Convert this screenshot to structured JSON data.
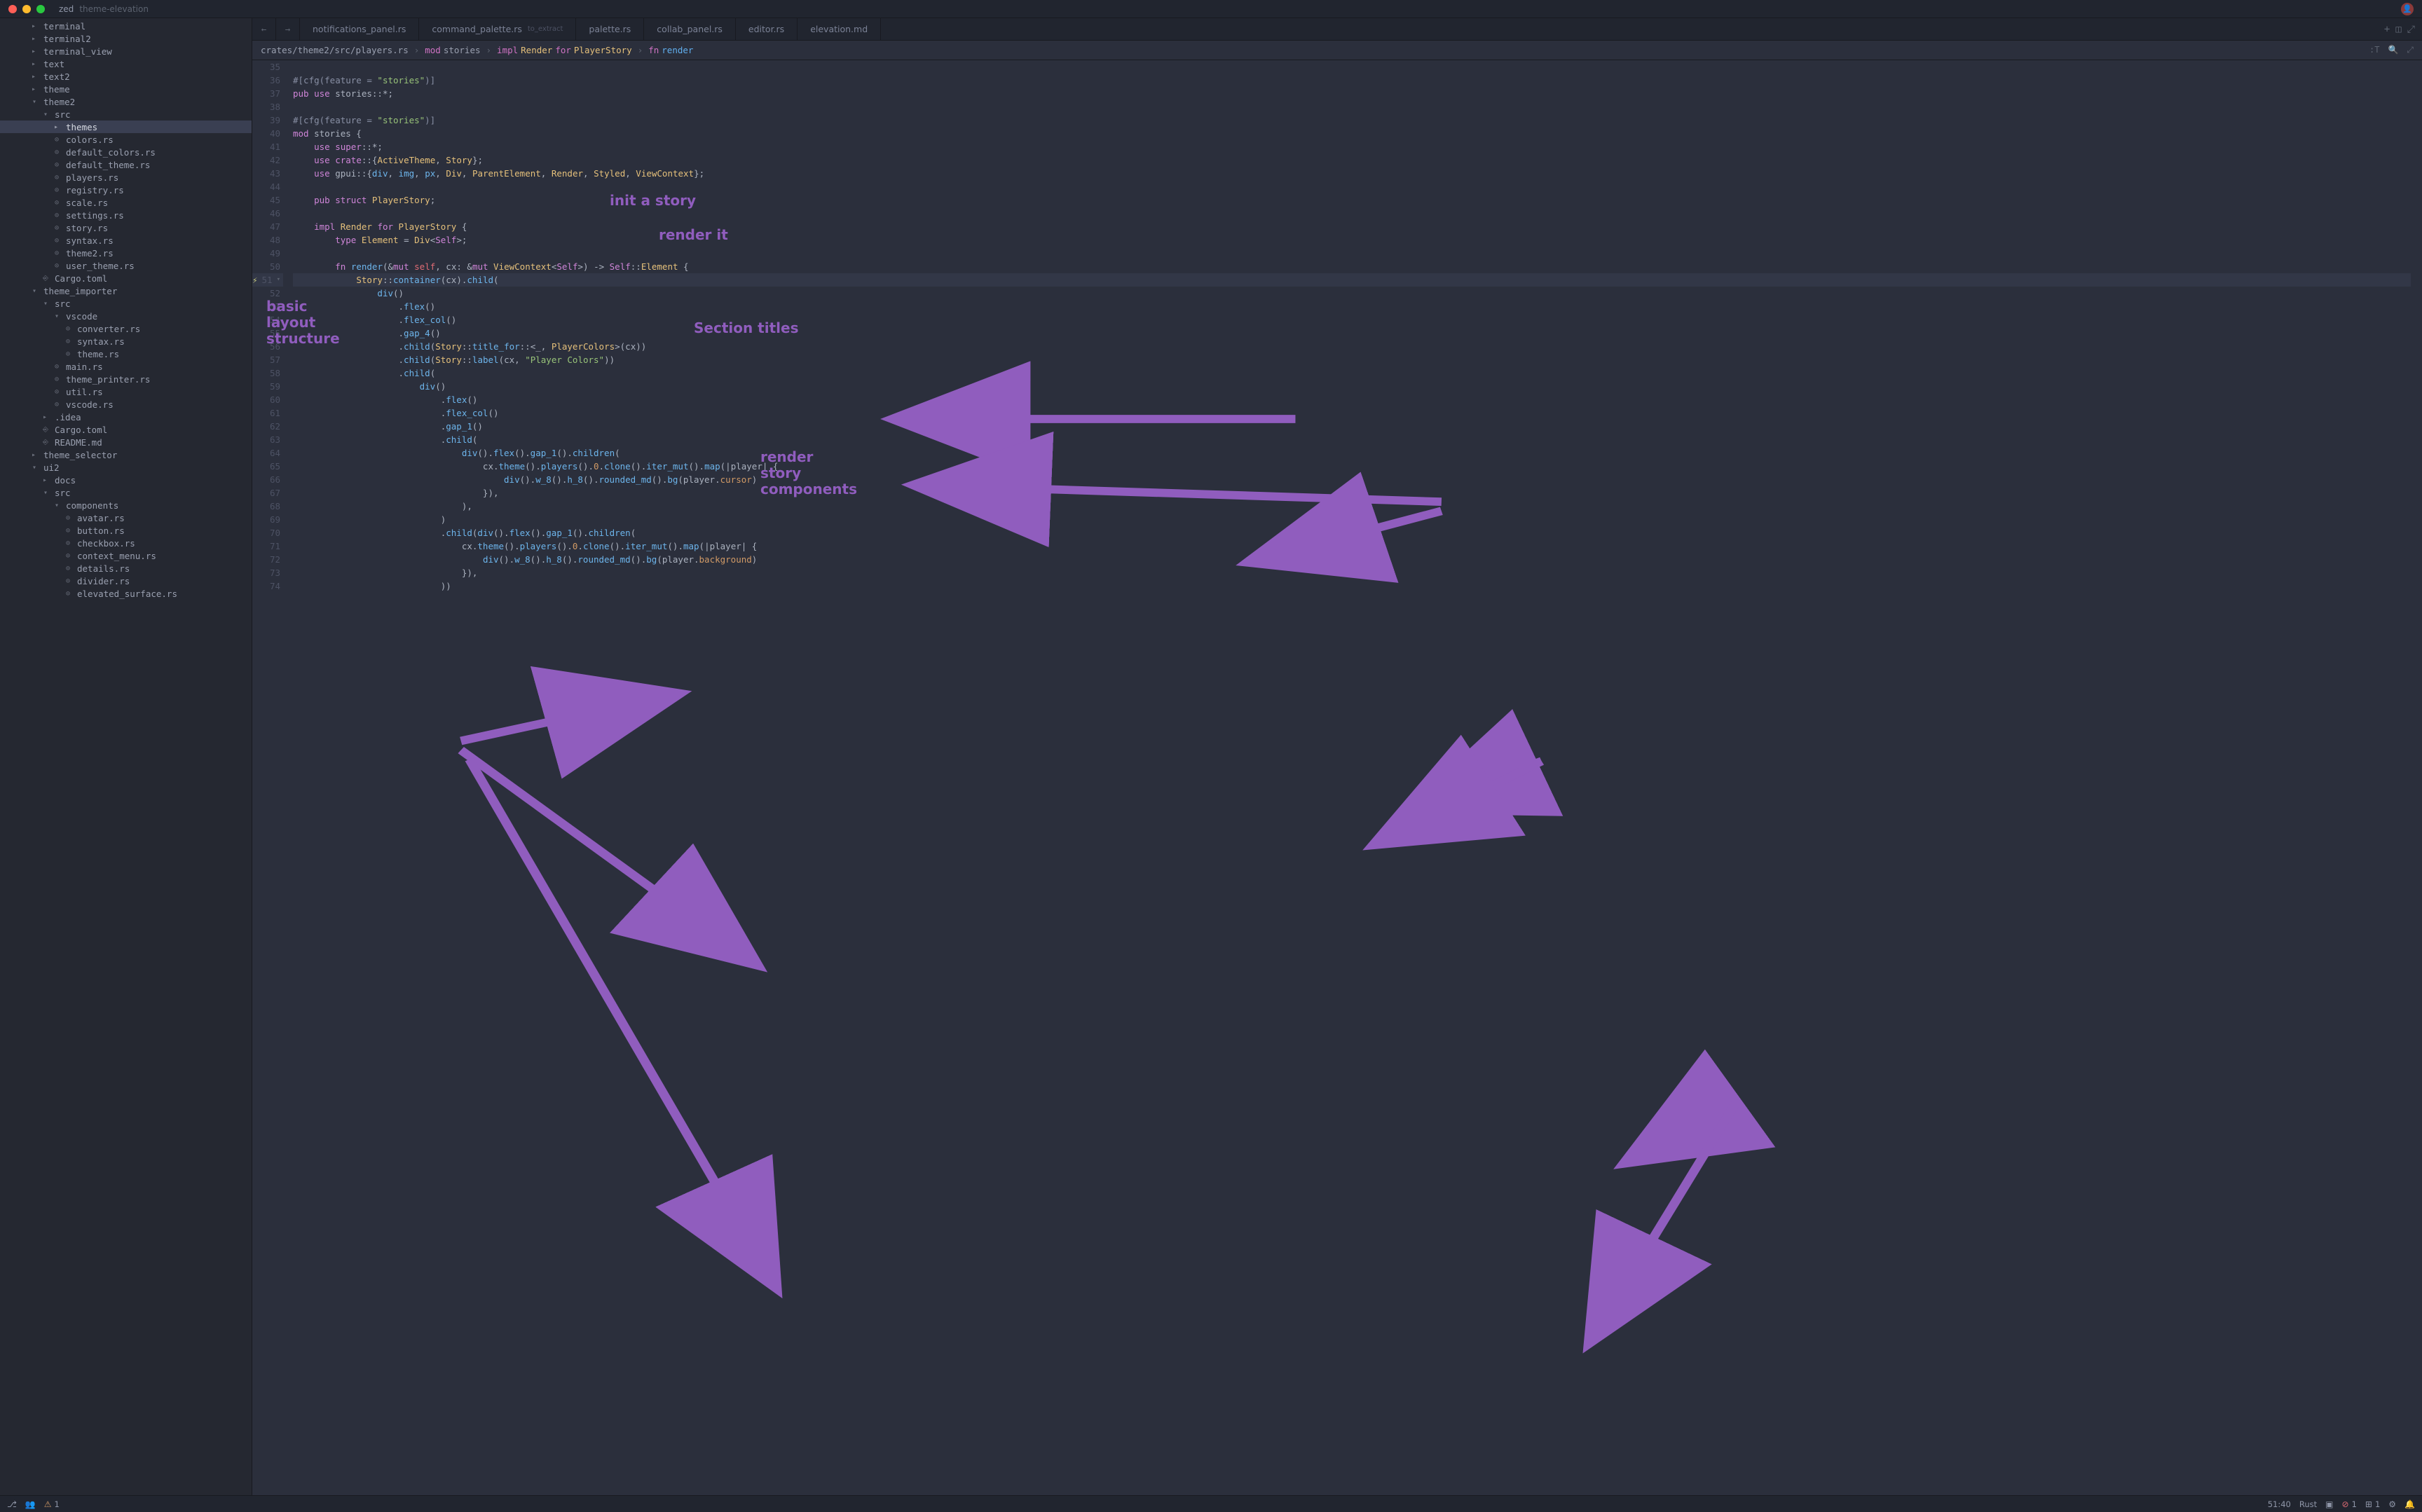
{
  "titlebar": {
    "app": "zed",
    "branch": "theme-elevation"
  },
  "tree": [
    {
      "d": 2,
      "k": "folder",
      "n": "terminal"
    },
    {
      "d": 2,
      "k": "folder",
      "n": "terminal2"
    },
    {
      "d": 2,
      "k": "folder",
      "n": "terminal_view"
    },
    {
      "d": 2,
      "k": "folder",
      "n": "text"
    },
    {
      "d": 2,
      "k": "folder",
      "n": "text2"
    },
    {
      "d": 2,
      "k": "folder",
      "n": "theme"
    },
    {
      "d": 2,
      "k": "folder-open",
      "n": "theme2"
    },
    {
      "d": 3,
      "k": "folder-open",
      "n": "src"
    },
    {
      "d": 4,
      "k": "folder",
      "n": "themes",
      "sel": true
    },
    {
      "d": 4,
      "k": "rust",
      "n": "colors.rs"
    },
    {
      "d": 4,
      "k": "rust",
      "n": "default_colors.rs"
    },
    {
      "d": 4,
      "k": "rust",
      "n": "default_theme.rs"
    },
    {
      "d": 4,
      "k": "rust",
      "n": "players.rs"
    },
    {
      "d": 4,
      "k": "rust",
      "n": "registry.rs"
    },
    {
      "d": 4,
      "k": "rust",
      "n": "scale.rs"
    },
    {
      "d": 4,
      "k": "rust",
      "n": "settings.rs"
    },
    {
      "d": 4,
      "k": "rust",
      "n": "story.rs"
    },
    {
      "d": 4,
      "k": "rust",
      "n": "syntax.rs"
    },
    {
      "d": 4,
      "k": "rust",
      "n": "theme2.rs"
    },
    {
      "d": 4,
      "k": "rust",
      "n": "user_theme.rs"
    },
    {
      "d": 3,
      "k": "file",
      "n": "Cargo.toml"
    },
    {
      "d": 2,
      "k": "folder-open",
      "n": "theme_importer"
    },
    {
      "d": 3,
      "k": "folder-open",
      "n": "src"
    },
    {
      "d": 4,
      "k": "folder-open",
      "n": "vscode"
    },
    {
      "d": 5,
      "k": "rust",
      "n": "converter.rs"
    },
    {
      "d": 5,
      "k": "rust",
      "n": "syntax.rs"
    },
    {
      "d": 5,
      "k": "rust",
      "n": "theme.rs"
    },
    {
      "d": 4,
      "k": "rust",
      "n": "main.rs"
    },
    {
      "d": 4,
      "k": "rust",
      "n": "theme_printer.rs"
    },
    {
      "d": 4,
      "k": "rust",
      "n": "util.rs"
    },
    {
      "d": 4,
      "k": "rust",
      "n": "vscode.rs"
    },
    {
      "d": 3,
      "k": "folder",
      "n": ".idea"
    },
    {
      "d": 3,
      "k": "file",
      "n": "Cargo.toml"
    },
    {
      "d": 3,
      "k": "file",
      "n": "README.md"
    },
    {
      "d": 2,
      "k": "folder",
      "n": "theme_selector"
    },
    {
      "d": 2,
      "k": "folder-open",
      "n": "ui2"
    },
    {
      "d": 3,
      "k": "folder",
      "n": "docs"
    },
    {
      "d": 3,
      "k": "folder-open",
      "n": "src"
    },
    {
      "d": 4,
      "k": "folder-open",
      "n": "components"
    },
    {
      "d": 5,
      "k": "rust",
      "n": "avatar.rs"
    },
    {
      "d": 5,
      "k": "rust",
      "n": "button.rs"
    },
    {
      "d": 5,
      "k": "rust",
      "n": "checkbox.rs"
    },
    {
      "d": 5,
      "k": "rust",
      "n": "context_menu.rs"
    },
    {
      "d": 5,
      "k": "rust",
      "n": "details.rs"
    },
    {
      "d": 5,
      "k": "rust",
      "n": "divider.rs"
    },
    {
      "d": 5,
      "k": "rust",
      "n": "elevated_surface.rs"
    }
  ],
  "tabs": [
    {
      "label": "notifications_panel.rs",
      "extra": ""
    },
    {
      "label": "command_palette.rs",
      "extra": "to_extract"
    },
    {
      "label": "palette.rs",
      "extra": ""
    },
    {
      "label": "collab_panel.rs",
      "extra": ""
    },
    {
      "label": "editor.rs",
      "extra": ""
    },
    {
      "label": "elevation.md",
      "extra": ""
    }
  ],
  "breadcrumb": {
    "path": "crates/theme2/src/players.rs",
    "seg1_kw": "mod",
    "seg1_id": "stories",
    "seg2_kw": "impl",
    "seg2_ty": "Render",
    "seg2_for": "for",
    "seg2_ty2": "PlayerStory",
    "seg3_kw": "fn",
    "seg3_fn": "render",
    "inlay": ":T"
  },
  "annotations": {
    "a1": "init a story",
    "a2": "render it",
    "a3": "basic layout structure",
    "a4": "Section titles",
    "a5": "render story components"
  },
  "code": {
    "start": 35,
    "current": 51,
    "lines": [
      {
        "n": 35,
        "t": ""
      },
      {
        "n": 36,
        "t": "#[cfg(feature = \"stories\")]",
        "cls": "attr"
      },
      {
        "n": 37,
        "html": "<span class='tk-kw'>pub</span> <span class='tk-kw'>use</span> stories::*;"
      },
      {
        "n": 38,
        "t": ""
      },
      {
        "n": 39,
        "t": "#[cfg(feature = \"stories\")]",
        "cls": "attr"
      },
      {
        "n": 40,
        "html": "<span class='tk-kw'>mod</span> stories {"
      },
      {
        "n": 41,
        "html": "    <span class='tk-kw'>use</span> <span class='tk-kw2'>super</span>::*;"
      },
      {
        "n": 42,
        "html": "    <span class='tk-kw'>use</span> <span class='tk-kw2'>crate</span>::{<span class='tk-type'>ActiveTheme</span>, <span class='tk-type'>Story</span>};"
      },
      {
        "n": 43,
        "html": "    <span class='tk-kw'>use</span> gpui::{<span class='tk-fn'>div</span>, <span class='tk-fn'>img</span>, <span class='tk-fn'>px</span>, <span class='tk-type'>Div</span>, <span class='tk-type'>ParentElement</span>, <span class='tk-type'>Render</span>, <span class='tk-type'>Styled</span>, <span class='tk-type'>ViewContext</span>};"
      },
      {
        "n": 44,
        "t": ""
      },
      {
        "n": 45,
        "html": "    <span class='tk-kw'>pub</span> <span class='tk-kw'>struct</span> <span class='tk-type'>PlayerStory</span>;"
      },
      {
        "n": 46,
        "t": ""
      },
      {
        "n": 47,
        "html": "    <span class='tk-kw'>impl</span> <span class='tk-type'>Render</span> <span class='tk-kw'>for</span> <span class='tk-type'>PlayerStory</span> {"
      },
      {
        "n": 48,
        "html": "        <span class='tk-kw'>type</span> <span class='tk-type'>Element</span> = <span class='tk-type'>Div</span>&lt;<span class='tk-kw2'>Self</span>&gt;;"
      },
      {
        "n": 49,
        "t": ""
      },
      {
        "n": 50,
        "html": "        <span class='tk-kw'>fn</span> <span class='tk-fn'>render</span>(&amp;<span class='tk-kw'>mut</span> <span class='tk-self'>self</span>, cx: &amp;<span class='tk-kw'>mut</span> <span class='tk-type'>ViewContext</span>&lt;<span class='tk-kw2'>Self</span>&gt;) <span class='tk-punct'>-&gt;</span> <span class='tk-kw2'>Self</span>::<span class='tk-type'>Element</span> {"
      },
      {
        "n": 51,
        "html": "            <span class='tk-type'>Story</span>::<span class='tk-fn'>container</span>(cx).<span class='tk-fn'>child</span>(",
        "zap": true,
        "chev": true,
        "cur": true
      },
      {
        "n": 52,
        "html": "                <span class='tk-fn'>div</span>()"
      },
      {
        "n": 53,
        "html": "                    .<span class='tk-fn'>flex</span>()"
      },
      {
        "n": 54,
        "html": "                    .<span class='tk-fn'>flex_col</span>()"
      },
      {
        "n": 55,
        "html": "                    .<span class='tk-fn'>gap_4</span>()"
      },
      {
        "n": 56,
        "html": "                    .<span class='tk-fn'>child</span>(<span class='tk-type'>Story</span>::<span class='tk-fn'>title_for</span>::&lt;_, <span class='tk-type'>PlayerColors</span>&gt;(cx))"
      },
      {
        "n": 57,
        "html": "                    .<span class='tk-fn'>child</span>(<span class='tk-type'>Story</span>::<span class='tk-fn'>label</span>(cx, <span class='tk-str'>\"Player Colors\"</span>))"
      },
      {
        "n": 58,
        "html": "                    .<span class='tk-fn'>child</span>("
      },
      {
        "n": 59,
        "html": "                        <span class='tk-fn'>div</span>()"
      },
      {
        "n": 60,
        "html": "                            .<span class='tk-fn'>flex</span>()"
      },
      {
        "n": 61,
        "html": "                            .<span class='tk-fn'>flex_col</span>()"
      },
      {
        "n": 62,
        "html": "                            .<span class='tk-fn'>gap_1</span>()"
      },
      {
        "n": 63,
        "html": "                            .<span class='tk-fn'>child</span>("
      },
      {
        "n": 64,
        "html": "                                <span class='tk-fn'>div</span>().<span class='tk-fn'>flex</span>().<span class='tk-fn'>gap_1</span>().<span class='tk-fn'>children</span>("
      },
      {
        "n": 65,
        "html": "                                    cx.<span class='tk-fn'>theme</span>().<span class='tk-fn'>players</span>().<span class='tk-const'>0</span>.<span class='tk-fn'>clone</span>().<span class='tk-fn'>iter_mut</span>().<span class='tk-fn'>map</span>(|player| {"
      },
      {
        "n": 66,
        "html": "                                        <span class='tk-fn'>div</span>().<span class='tk-fn'>w_8</span>().<span class='tk-fn'>h_8</span>().<span class='tk-fn'>rounded_md</span>().<span class='tk-fn'>bg</span>(player.<span class='tk-field-cu'>cursor</span>)"
      },
      {
        "n": 67,
        "html": "                                    }),"
      },
      {
        "n": 68,
        "html": "                                ),"
      },
      {
        "n": 69,
        "html": "                            )"
      },
      {
        "n": 70,
        "html": "                            .<span class='tk-fn'>child</span>(<span class='tk-fn'>div</span>().<span class='tk-fn'>flex</span>().<span class='tk-fn'>gap_1</span>().<span class='tk-fn'>children</span>("
      },
      {
        "n": 71,
        "html": "                                cx.<span class='tk-fn'>theme</span>().<span class='tk-fn'>players</span>().<span class='tk-const'>0</span>.<span class='tk-fn'>clone</span>().<span class='tk-fn'>iter_mut</span>().<span class='tk-fn'>map</span>(|player| {"
      },
      {
        "n": 72,
        "html": "                                    <span class='tk-fn'>div</span>().<span class='tk-fn'>w_8</span>().<span class='tk-fn'>h_8</span>().<span class='tk-fn'>rounded_md</span>().<span class='tk-fn'>bg</span>(player.<span class='tk-field-bg'>background</span>)"
      },
      {
        "n": 73,
        "html": "                                }),"
      },
      {
        "n": 74,
        "html": "                            ))"
      }
    ]
  },
  "statusbar": {
    "warnings": "1",
    "pos": "51:40",
    "lang": "Rust",
    "diag_err": "1",
    "diag_warn": "1"
  }
}
